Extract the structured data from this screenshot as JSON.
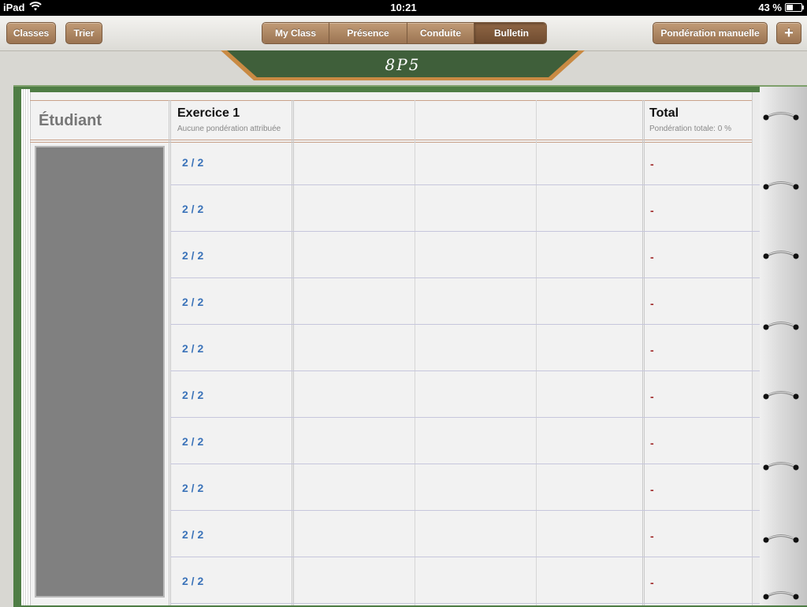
{
  "status_bar": {
    "device": "iPad",
    "time": "10:21",
    "battery": "43 %",
    "battery_level": 0.43
  },
  "toolbar": {
    "classes_label": "Classes",
    "sort_label": "Trier",
    "segments": [
      {
        "label": "My Class",
        "active": false
      },
      {
        "label": "Présence",
        "active": false
      },
      {
        "label": "Conduite",
        "active": false
      },
      {
        "label": "Bulletin",
        "active": true
      }
    ],
    "manual_weighting_label": "Pondération manuelle",
    "add_label": "+"
  },
  "board": {
    "title": "8P5"
  },
  "gradebook": {
    "student_header": "Étudiant",
    "exercise": {
      "title": "Exercice 1",
      "subtitle": "Aucune pondération attribuée"
    },
    "total": {
      "title": "Total",
      "subtitle": "Pondération totale: 0 %"
    },
    "rows": [
      {
        "score": "2 / 2",
        "total": "-"
      },
      {
        "score": "2 / 2",
        "total": "-"
      },
      {
        "score": "2 / 2",
        "total": "-"
      },
      {
        "score": "2 / 2",
        "total": "-"
      },
      {
        "score": "2 / 2",
        "total": "-"
      },
      {
        "score": "2 / 2",
        "total": "-"
      },
      {
        "score": "2 / 2",
        "total": "-"
      },
      {
        "score": "2 / 2",
        "total": "-"
      },
      {
        "score": "2 / 2",
        "total": "-"
      },
      {
        "score": "2 / 2",
        "total": "-"
      }
    ]
  },
  "colors": {
    "accent_button": "#a67d59",
    "score_text": "#3b73b9",
    "total_text": "#a12a2a",
    "chalkboard": "#3f5f3a"
  }
}
